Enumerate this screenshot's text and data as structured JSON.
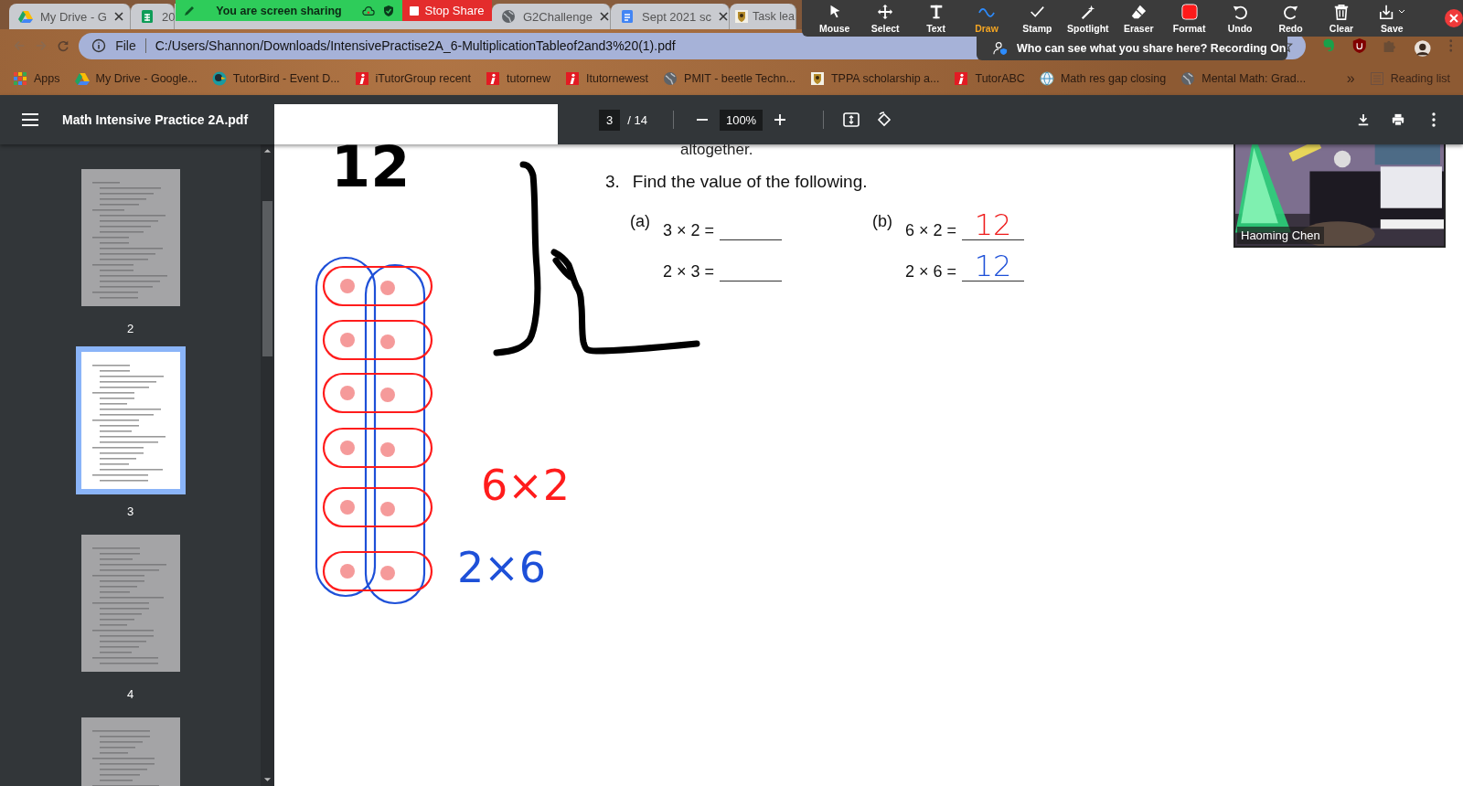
{
  "browser_tabs": [
    {
      "title": "My Drive - G",
      "kind": "drive",
      "closable": true
    },
    {
      "title": "20",
      "kind": "sheets"
    },
    {
      "title": "G2Challenge",
      "kind": "globe",
      "closable": true
    },
    {
      "title": "Sept 2021 sc",
      "kind": "docs",
      "closable": true
    },
    {
      "title": "Task lea",
      "kind": "crest"
    }
  ],
  "share_bar": {
    "status": "You are screen sharing",
    "stop": "Stop Share"
  },
  "annotate_toolbar": {
    "tools": [
      {
        "label": "Mouse",
        "kind": "mouse",
        "selected": false
      },
      {
        "label": "Select",
        "kind": "select",
        "selected": false
      },
      {
        "label": "Text",
        "kind": "text",
        "selected": false
      },
      {
        "label": "Draw",
        "kind": "draw",
        "selected": true
      },
      {
        "label": "Stamp",
        "kind": "stamp",
        "selected": false
      },
      {
        "label": "Spotlight",
        "kind": "spotlight",
        "selected": false
      },
      {
        "label": "Eraser",
        "kind": "eraser",
        "selected": false
      },
      {
        "label": "Format",
        "kind": "format",
        "selected": false
      },
      {
        "label": "Undo",
        "kind": "undo",
        "selected": false
      },
      {
        "label": "Redo",
        "kind": "redo",
        "selected": false
      },
      {
        "label": "Clear",
        "kind": "clear",
        "selected": false
      },
      {
        "label": "Save",
        "kind": "save",
        "selected": false
      }
    ]
  },
  "share_notice": "Who can see what you share here? Recording On",
  "address_bar": {
    "scheme": "File",
    "url": "C:/Users/Shannon/Downloads/IntensivePractise2A_6-MultiplicationTableof2and3%20(1).pdf"
  },
  "bookmarks": [
    {
      "label": "Apps",
      "kind": "apps"
    },
    {
      "label": "My Drive - Google...",
      "kind": "drive"
    },
    {
      "label": "TutorBird - Event D...",
      "kind": "bird"
    },
    {
      "label": "iTutorGroup recent",
      "kind": "itutor"
    },
    {
      "label": "tutornew",
      "kind": "itutor"
    },
    {
      "label": "Itutornewest",
      "kind": "itutor"
    },
    {
      "label": "PMIT - beetle Techn...",
      "kind": "globe"
    },
    {
      "label": "TPPA scholarship a...",
      "kind": "crest"
    },
    {
      "label": "TutorABC",
      "kind": "itutor"
    },
    {
      "label": "Math res gap closing",
      "kind": "ball"
    },
    {
      "label": "Mental Math: Grad...",
      "kind": "globe"
    }
  ],
  "bookmarks_overflow": "»",
  "reading_list": "Reading list",
  "pdf_viewer": {
    "title": "Math Intensive Practice 2A.pdf",
    "page": "3",
    "page_total": "/ 14",
    "zoom": "100%"
  },
  "thumbnails": [
    {
      "label": "2",
      "selected": false
    },
    {
      "label": "3",
      "selected": true
    },
    {
      "label": "4",
      "selected": false
    },
    {
      "selected": false
    }
  ],
  "worksheet": {
    "cut_text": "altogether.",
    "number": "3.",
    "prompt": "Find the value of the following.",
    "parts": [
      {
        "label": "(a)",
        "rows": [
          {
            "expr": "3 × 2 ="
          },
          {
            "expr": "2 × 3 ="
          }
        ]
      },
      {
        "label": "(b)",
        "rows": [
          {
            "expr": "6 × 2 =",
            "answer": "12",
            "color": "#ee1c1c"
          },
          {
            "expr": "2 × 6 =",
            "answer": "12",
            "color": "#1e50d8"
          }
        ]
      }
    ]
  },
  "ink_notes": [
    {
      "text": "12",
      "color": "#000000"
    },
    {
      "text": "6×2",
      "color": "#ff1c1c"
    },
    {
      "text": "2×6",
      "color": "#1e50d8"
    }
  ],
  "video": {
    "name": "Haoming Chen"
  }
}
